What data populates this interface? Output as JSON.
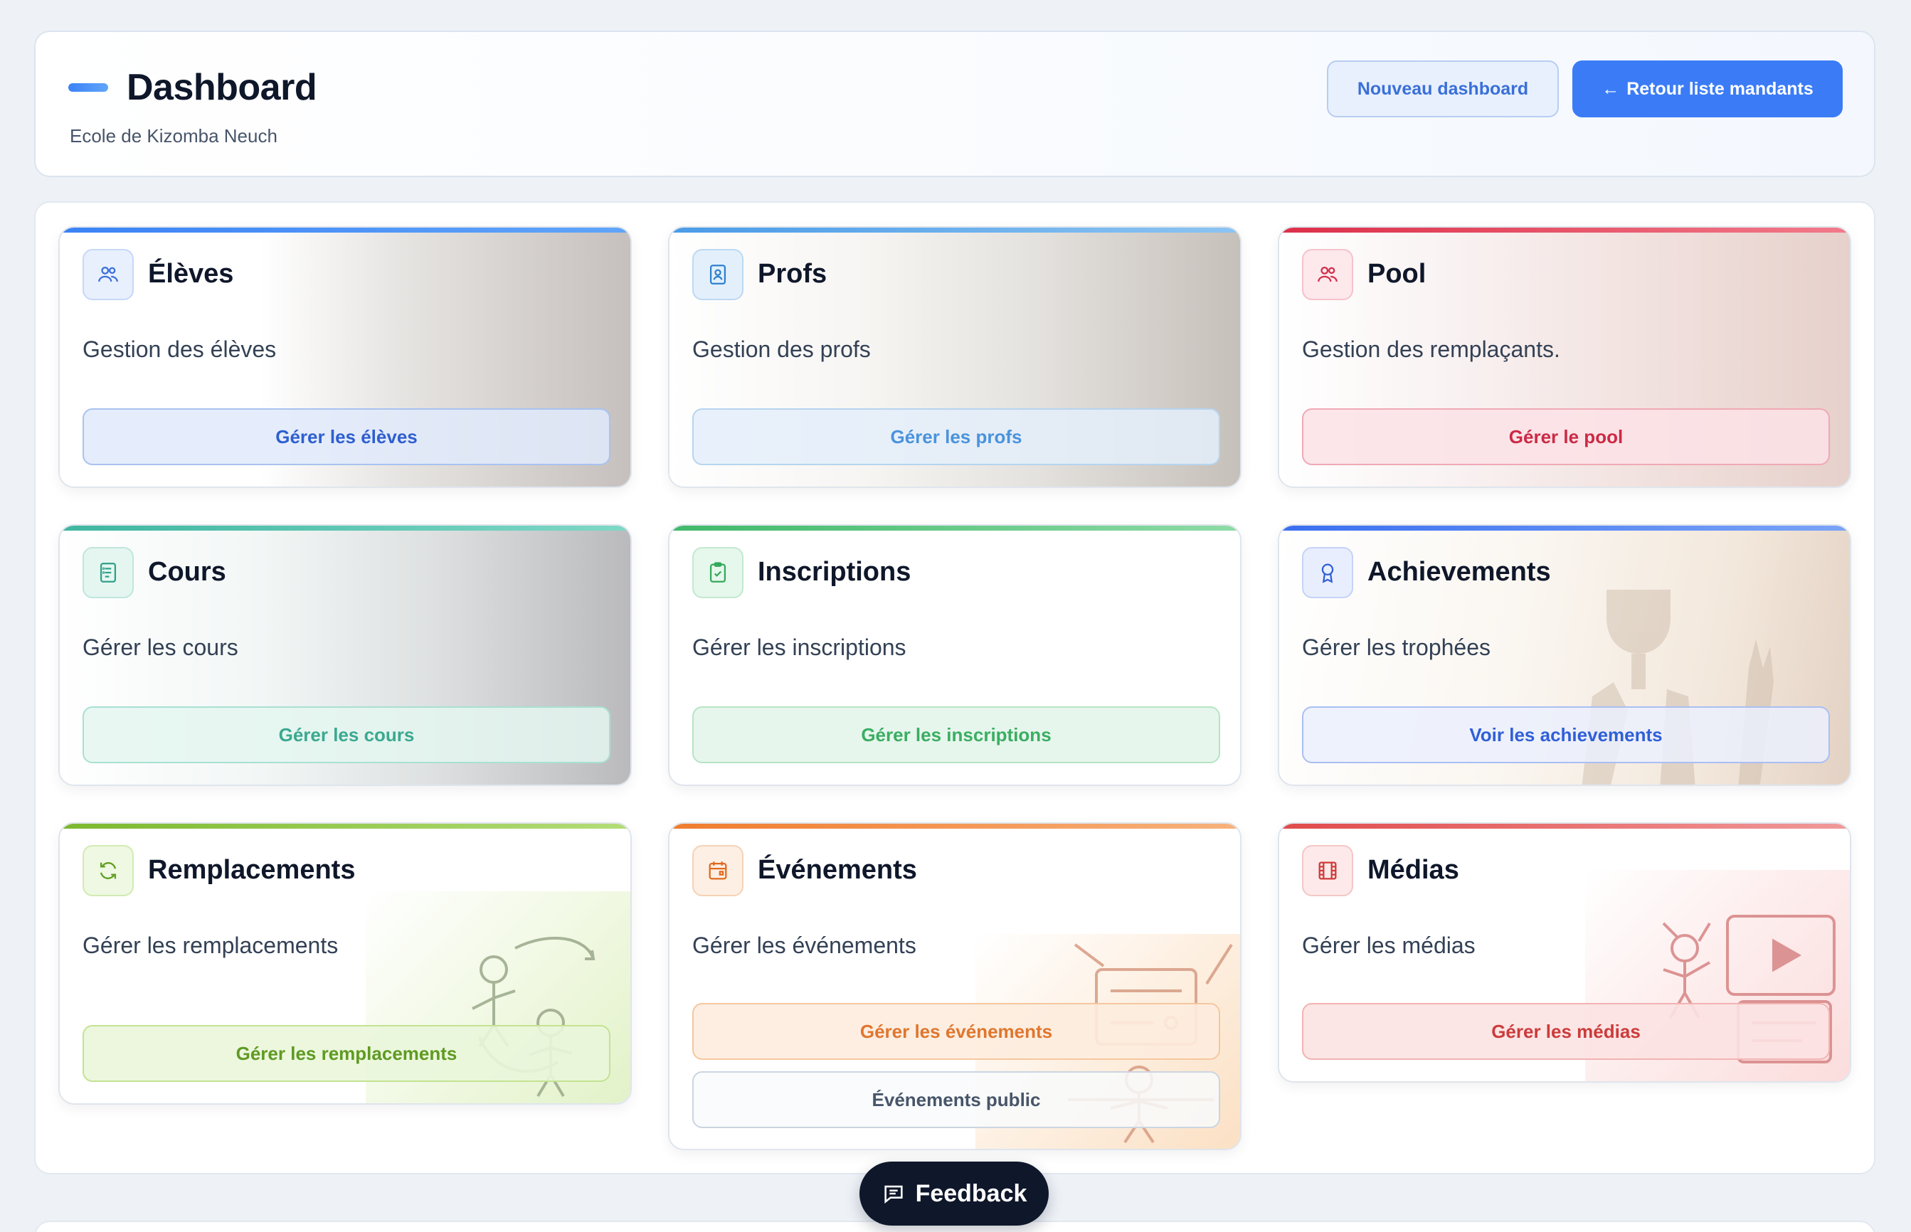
{
  "header": {
    "title": "Dashboard",
    "subtitle": "Ecole de Kizomba Neuch",
    "new_dashboard_label": "Nouveau dashboard",
    "back_label": "Retour liste mandants",
    "back_icon": "arrow-left-icon"
  },
  "tiles": [
    {
      "id": "eleves",
      "title": "Élèves",
      "description": "Gestion des élèves",
      "button": "Gérer les élèves",
      "icon": "users-icon",
      "accent": "#3b82f6"
    },
    {
      "id": "profs",
      "title": "Profs",
      "description": "Gestion des profs",
      "button": "Gérer les profs",
      "icon": "id-badge-icon",
      "accent": "#4a9be8"
    },
    {
      "id": "pool",
      "title": "Pool",
      "description": "Gestion des remplaçants.",
      "button": "Gérer le pool",
      "icon": "users-icon",
      "accent": "#dc2f4a"
    },
    {
      "id": "cours",
      "title": "Cours",
      "description": "Gérer les cours",
      "button": "Gérer les cours",
      "icon": "document-list-icon",
      "accent": "#3fb6a0"
    },
    {
      "id": "inscriptions",
      "title": "Inscriptions",
      "description": "Gérer les inscriptions",
      "button": "Gérer les inscriptions",
      "icon": "clipboard-check-icon",
      "accent": "#40b96a"
    },
    {
      "id": "achievements",
      "title": "Achievements",
      "description": "Gérer les trophées",
      "button": "Voir les achievements",
      "icon": "award-icon",
      "accent": "#3b6ff0"
    },
    {
      "id": "remplacements",
      "title": "Remplacements",
      "description": "Gérer les remplacements",
      "button": "Gérer les remplacements",
      "icon": "refresh-icon",
      "accent": "#7cb82f"
    },
    {
      "id": "evenements",
      "title": "Événements",
      "description": "Gérer les événements",
      "button": "Gérer les événements",
      "secondary_button": "Événements public",
      "icon": "calendar-icon",
      "accent": "#f07c2e"
    },
    {
      "id": "medias",
      "title": "Médias",
      "description": "Gérer les médias",
      "button": "Gérer les médias",
      "icon": "film-icon",
      "accent": "#e04b4b"
    }
  ],
  "feedback": {
    "label": "Feedback",
    "icon": "message-icon"
  }
}
